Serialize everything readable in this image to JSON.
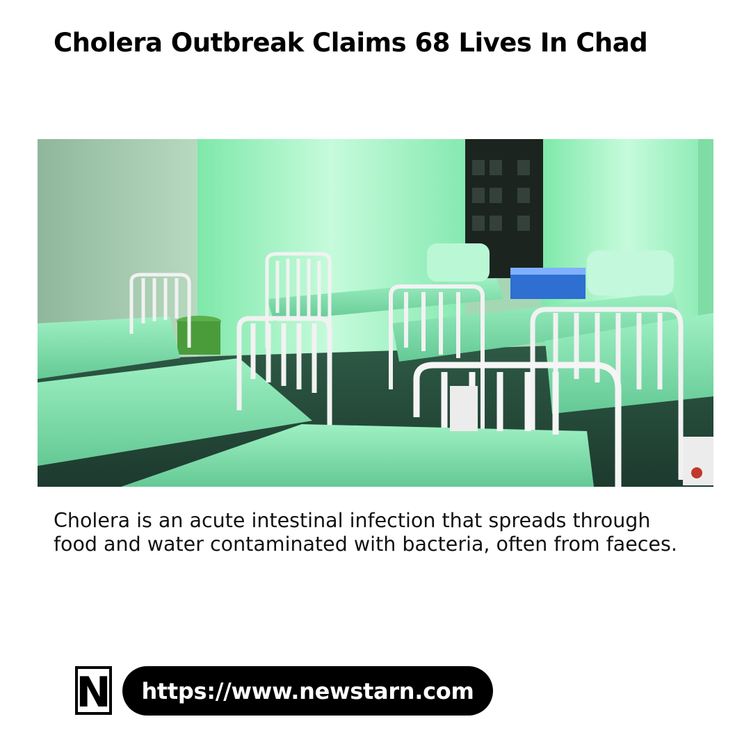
{
  "article": {
    "headline": "Cholera Outbreak Claims 68 Lives In Chad",
    "caption": "Cholera is an acute intestinal infection that spreads through food and water contaminated with bacteria, often from faeces."
  },
  "footer": {
    "logo_letter": "N",
    "url": "https://www.newstarn.com"
  },
  "colors": {
    "text": "#000000",
    "pill_bg": "#000000",
    "pill_text": "#ffffff",
    "sheet_green": "#7fe0b0",
    "wall_green": "#b9f5cf"
  }
}
